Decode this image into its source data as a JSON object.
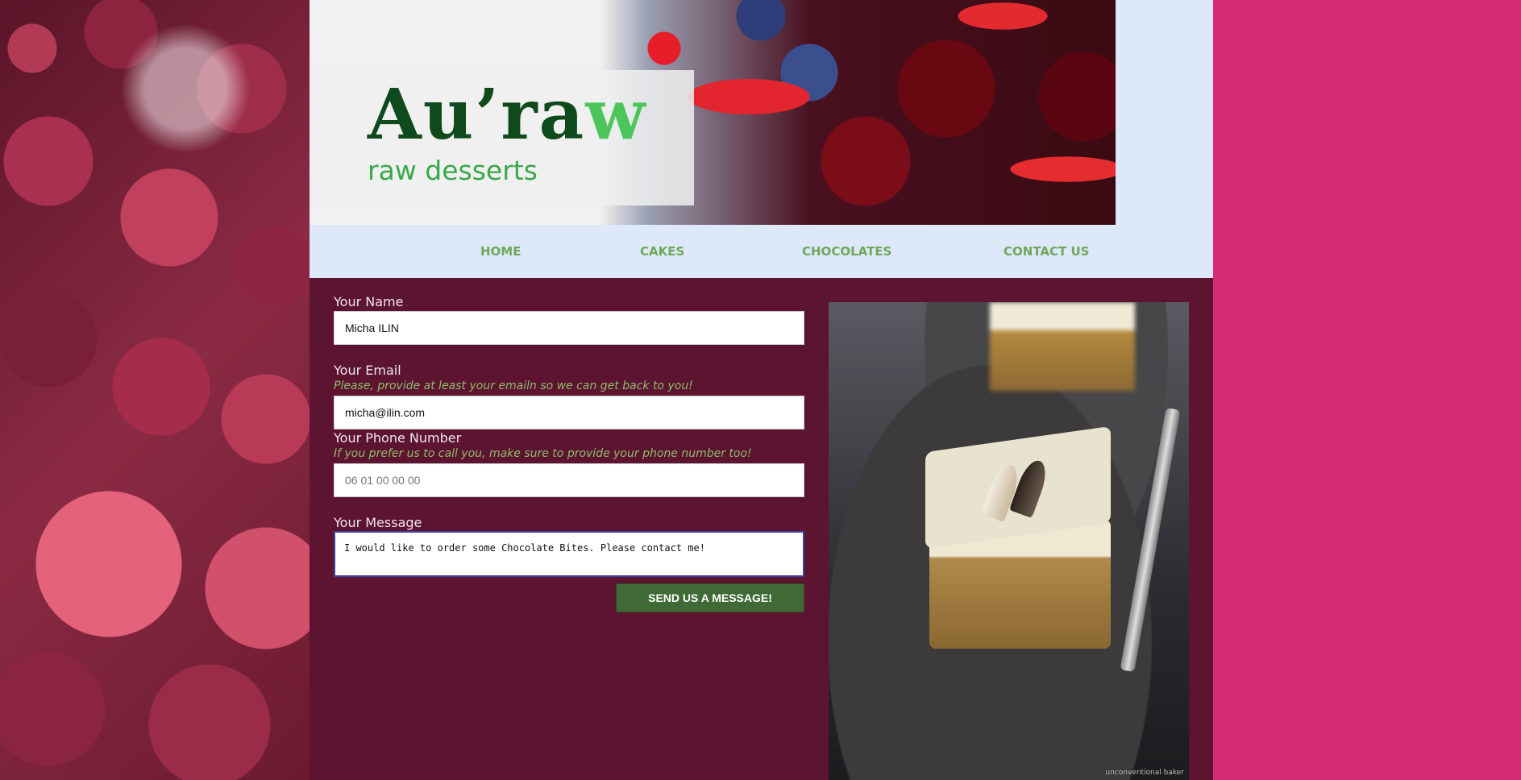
{
  "brand": {
    "title_main": "Au’ra",
    "title_accent": "w",
    "subtitle": "raw desserts"
  },
  "nav": {
    "items": [
      {
        "label": "HOME"
      },
      {
        "label": "CAKES"
      },
      {
        "label": "CHOCOLATES"
      },
      {
        "label": "CONTACT US"
      }
    ]
  },
  "form": {
    "name": {
      "label": "Your Name",
      "value": "Micha ILIN"
    },
    "email": {
      "label": "Your Email",
      "hint": "Please, provide at least your emailn so we can get back to you!",
      "value": "micha@ilin.com"
    },
    "phone": {
      "label": "Your Phone Number",
      "hint": "If you prefer us to call you, make sure to provide your phone number too!",
      "placeholder": "06 01 00 00 00"
    },
    "message": {
      "label": "Your Message",
      "value": "I would like to order some Chocolate Bites. Please contact me!"
    },
    "submit_label": "SEND US A MESSAGE!"
  },
  "photo": {
    "credit": "unconventional baker"
  },
  "colors": {
    "background_pink": "#d42b74",
    "main_panel": "#5c1431",
    "nav_bar": "#dde8f8",
    "nav_link": "#6fa85c",
    "button": "#3f6a35",
    "hint_text": "#8fbd6a"
  }
}
